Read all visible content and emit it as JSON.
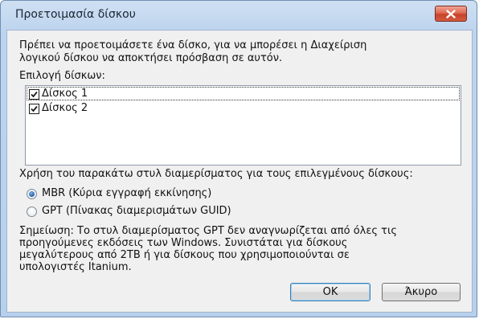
{
  "dialog": {
    "title": "Προετοιμασία δίσκου",
    "intro_line1": "Πρέπει να προετοιμάσετε ένα δίσκο, για να μπορέσει η Διαχείριση",
    "intro_line2": "λογικού δίσκου να αποκτήσει πρόσβαση σε αυτόν.",
    "select_label": "Επιλογή δίσκων:",
    "disks": [
      {
        "label": "Δίσκος 1",
        "checked": true
      },
      {
        "label": "Δίσκος 2",
        "checked": true
      }
    ],
    "partition_label": "Χρήση του παρακάτω στυλ διαμερίσματος για τους επιλεγμένους δίσκους:",
    "partition_options": [
      {
        "label": "MBR (Κύρια εγγραφή εκκίνησης)",
        "selected": true
      },
      {
        "label": "GPT (Πίνακας διαμερισμάτων GUID)",
        "selected": false
      }
    ],
    "note_lines": [
      "Σημείωση: Το στυλ διαμερίσματος GPT δεν αναγνωρίζεται από όλες τις",
      "προηγούμενες εκδόσεις των Windows. Συνιστάται για δίσκους",
      "μεγαλύτερους από 2TB ή για δίσκους που χρησιμοποιούνται σε",
      "υπολογιστές Itanium."
    ],
    "ok_label": "OK",
    "cancel_label": "Άκυρο"
  },
  "icons": {
    "close": "close-icon",
    "check": "checkmark-icon"
  },
  "colors": {
    "close_button": "#d45a3f",
    "titlebar": "#bdd4ee",
    "dialog_body": "#f0f0f0"
  }
}
